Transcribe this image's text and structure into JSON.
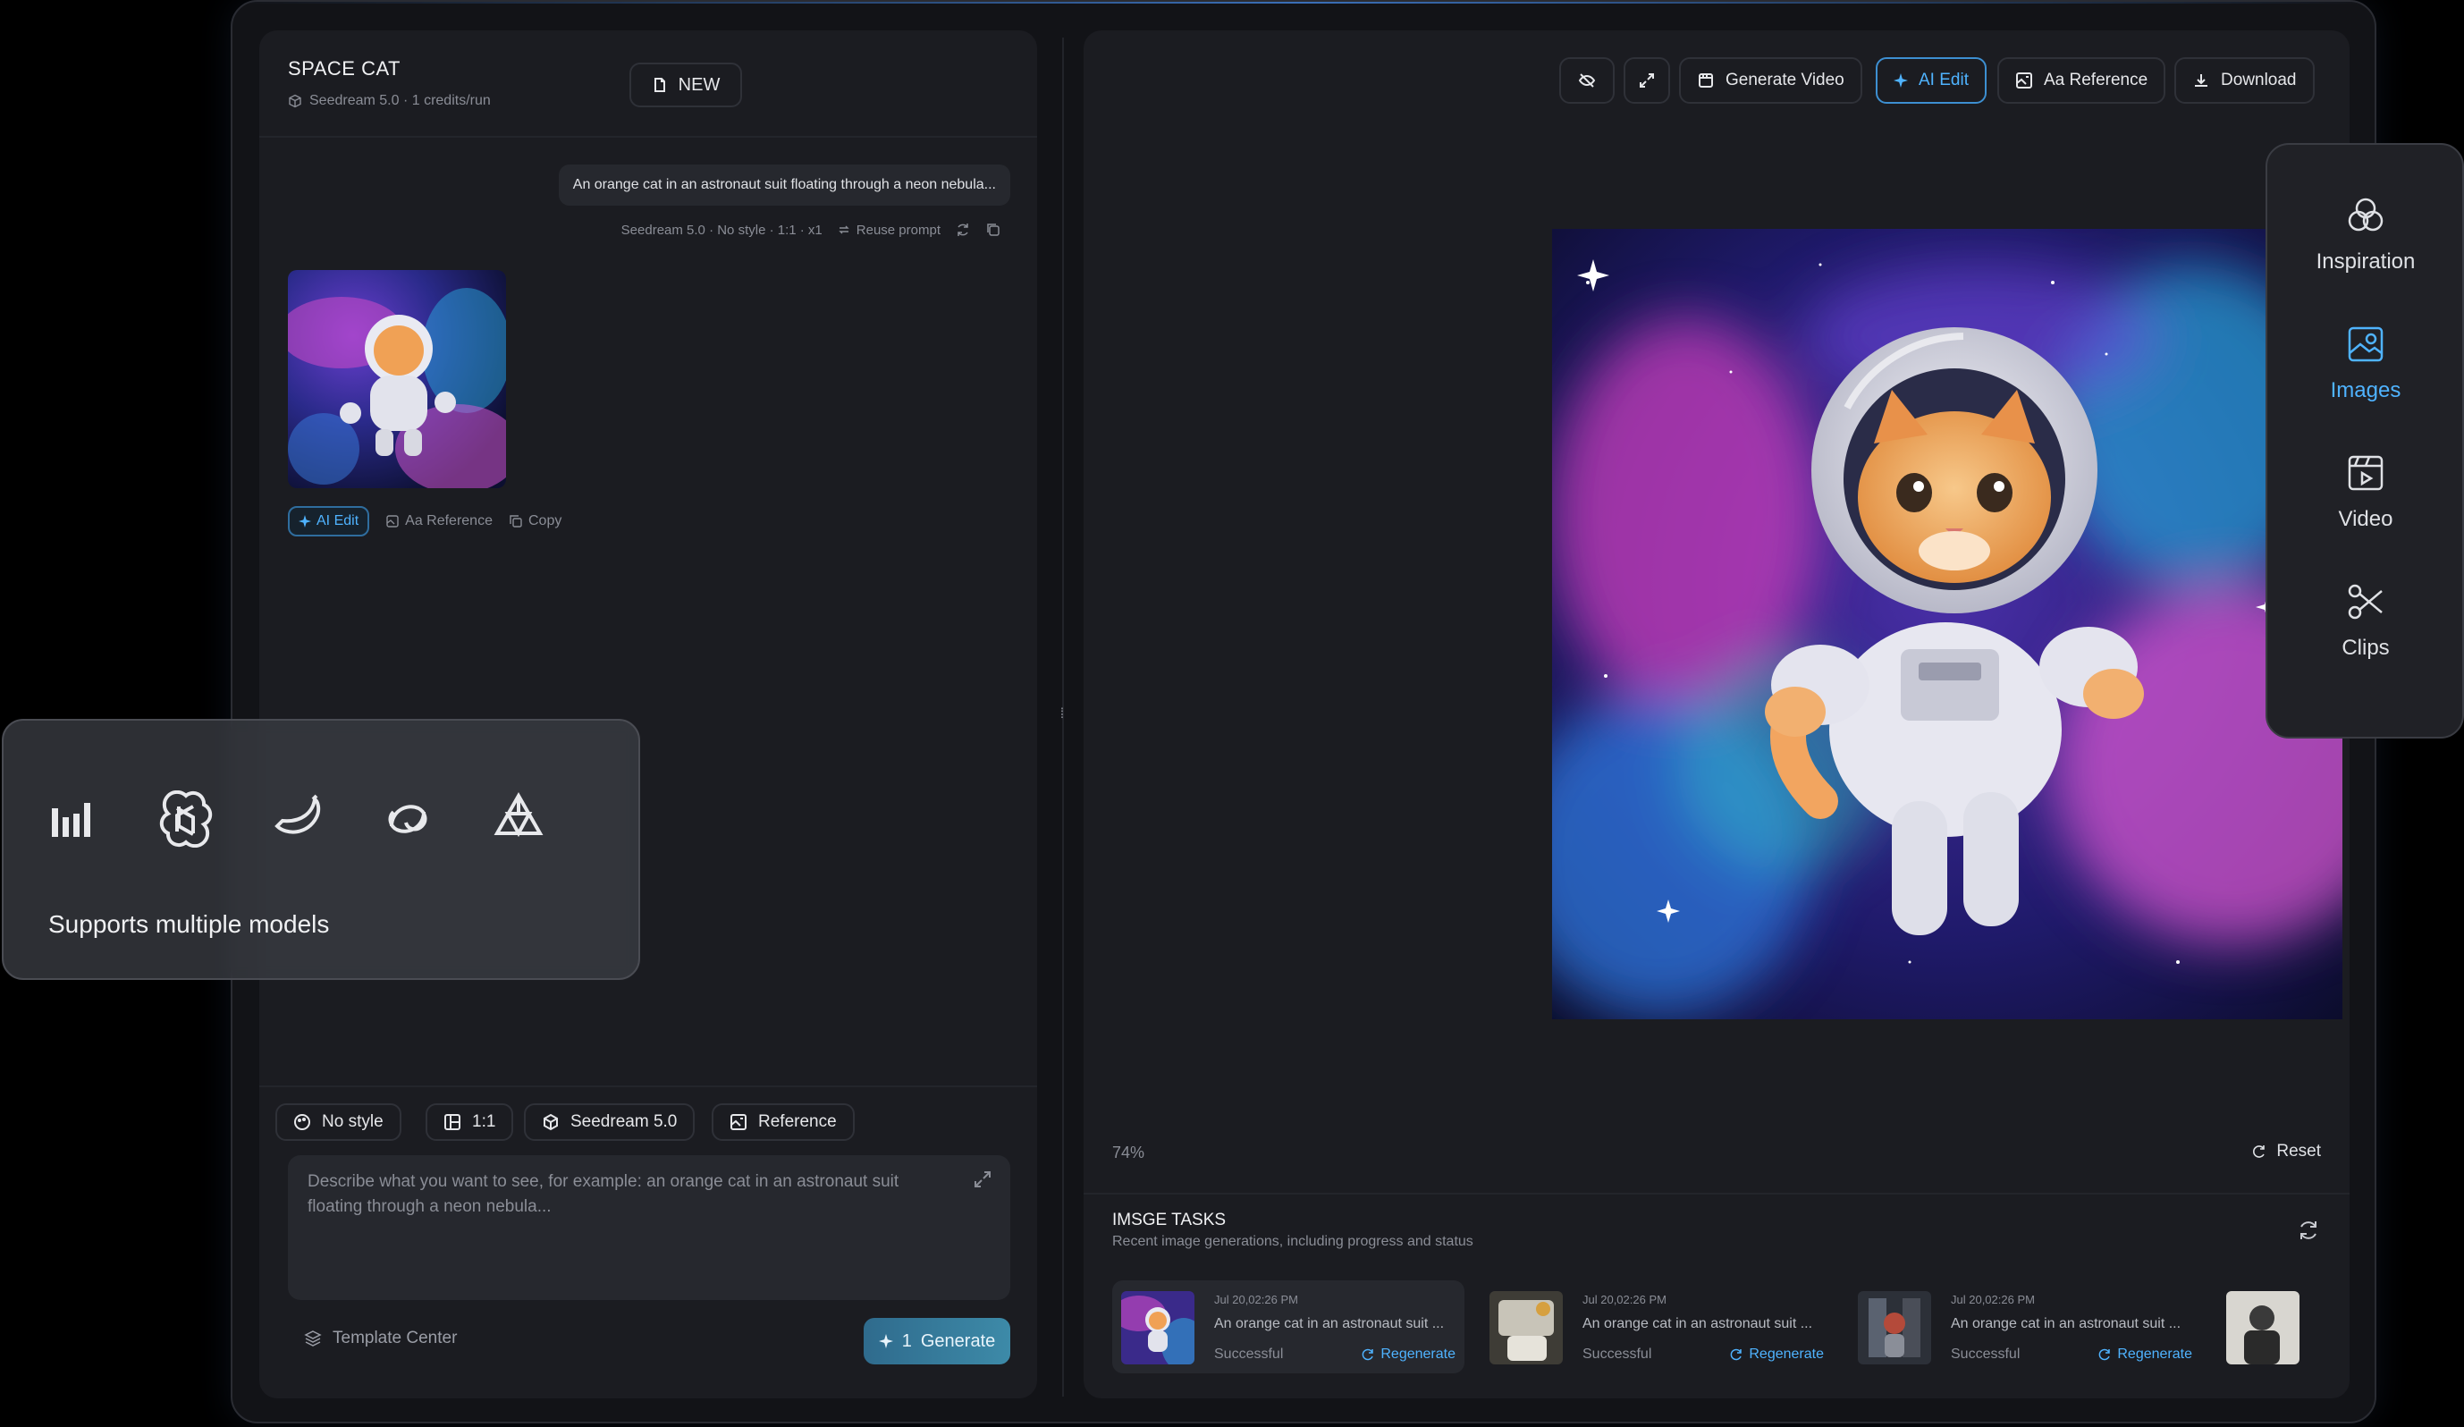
{
  "project": {
    "title": "SPACE CAT",
    "subtitle": "Seedream 5.0 · 1 credits/run",
    "new_label": "NEW"
  },
  "chat": {
    "prompt": "An orange cat in an astronaut suit floating through a neon nebula...",
    "meta": "Seedream 5.0 · No style · 1:1 · x1",
    "reuse_label": "Reuse prompt",
    "actions": {
      "ai_edit": "AI Edit",
      "reference": "Aa Reference",
      "copy": "Copy"
    }
  },
  "models_popup": {
    "label": "Supports multiple models"
  },
  "composer": {
    "options": {
      "style": "No style",
      "ratio": "1:1",
      "model": "Seedream 5.0",
      "reference": "Reference"
    },
    "placeholder": "Describe what you want to see, for example: an orange cat in an astronaut suit floating through a neon nebula...",
    "template_label": "Template Center",
    "generate_cost": "1",
    "generate_label": "Generate"
  },
  "toolbar": {
    "generate_video": "Generate Video",
    "ai_edit": "AI Edit",
    "reference": "Aa Reference",
    "download": "Download"
  },
  "viewer": {
    "zoom": "74%",
    "reset_label": "Reset"
  },
  "tasks": {
    "title": "IMSGE TASKS",
    "subtitle": "Recent image generations, including progress and status",
    "items": [
      {
        "date": "Jul 20,02:26 PM",
        "prompt": "An orange cat in an astronaut suit ...",
        "status": "Successful",
        "action": "Regenerate"
      },
      {
        "date": "Jul 20,02:26 PM",
        "prompt": "An orange cat in an astronaut suit ...",
        "status": "Successful",
        "action": "Regenerate"
      },
      {
        "date": "Jul 20,02:26 PM",
        "prompt": "An orange cat in an astronaut suit ...",
        "status": "Successful",
        "action": "Regenerate"
      }
    ]
  },
  "sidenav": {
    "items": [
      {
        "label": "Inspiration",
        "icon": "circles-icon"
      },
      {
        "label": "Images",
        "icon": "image-icon"
      },
      {
        "label": "Video",
        "icon": "video-icon"
      },
      {
        "label": "Clips",
        "icon": "scissors-icon"
      }
    ],
    "active": "Images"
  },
  "colors": {
    "accent": "#4fb3ff",
    "background": "#121317",
    "panel": "#1b1c21"
  }
}
